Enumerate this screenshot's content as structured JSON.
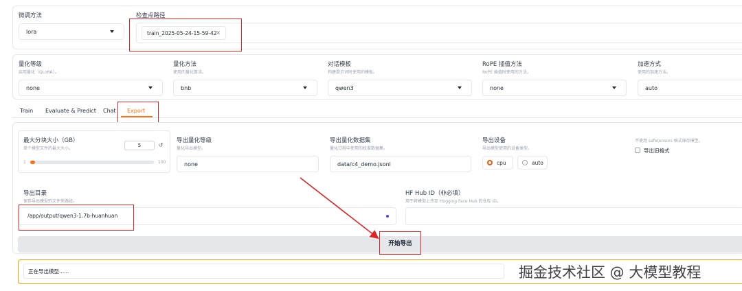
{
  "top": {
    "finetune": {
      "label": "微调方法",
      "value": "lora"
    },
    "checkpoint": {
      "label": "检查点路径",
      "tag": "train_2025-05-24-15-59-42"
    }
  },
  "settings": {
    "quant_level": {
      "label": "量化等级",
      "hint": "启用量化（QLoRA）。",
      "value": "none"
    },
    "quant_method": {
      "label": "量化方法",
      "hint": "使用的量化算法。",
      "value": "bnb"
    },
    "template": {
      "label": "对话模板",
      "hint": "构建提示词时使用的模板。",
      "value": "qwen3"
    },
    "rope": {
      "label": "RoPE 插值方法",
      "hint": "RoPE 插值时使用的方法。",
      "value": "none"
    },
    "accel": {
      "label": "加速方式",
      "hint": "使用的加速方法。",
      "value": "auto"
    }
  },
  "tabs": [
    "Train",
    "Evaluate & Predict",
    "Chat",
    "Export"
  ],
  "export": {
    "shard": {
      "label": "最大分块大小（GB）",
      "hint": "单个模型文件的最大大小。",
      "value": "5",
      "min": "1",
      "max": "100",
      "fraction": 0.04
    },
    "quant_bit": {
      "label": "导出量化等级",
      "hint": "量化导出模型。",
      "value": "none"
    },
    "dataset": {
      "label": "导出量化数据集",
      "hint": "量化过程中使用的校准数据集。",
      "value": "data/c4_demo.jsonl"
    },
    "device": {
      "label": "导出设备",
      "hint": "导出模型使用的设备类型。",
      "options": [
        "cpu",
        "auto"
      ]
    },
    "legacy": {
      "hint": "不使用 safetensors 格式保存模型。",
      "label": "导出旧格式"
    },
    "dir": {
      "label": "导出目录",
      "hint": "保存导出模型的文件夹路径。",
      "value": "/app/output/qwen3-1.7b-huanhuan"
    },
    "hub": {
      "label": "HF Hub ID（非必填）",
      "hint": "用于将模型上传至 Hugging Face Hub 的仓库 ID。"
    },
    "button": "开始导出",
    "status": "正在导出模型......"
  },
  "watermark": "掘金技术社区 @ 大模型教程",
  "colors": {
    "accent": "#f97316",
    "annotation": "#dc2626",
    "radio": "#ea580c"
  }
}
